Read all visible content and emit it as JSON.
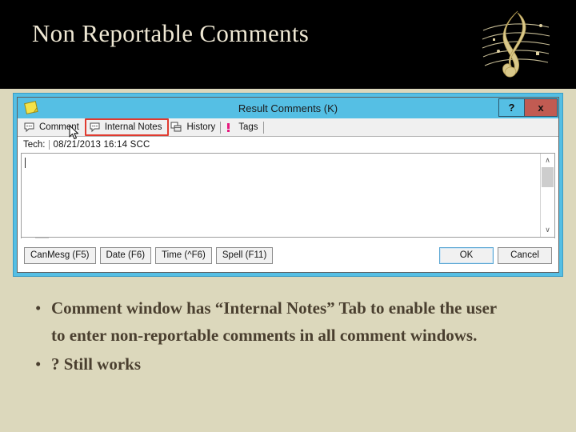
{
  "slide": {
    "title": "Non Reportable Comments",
    "decoration_icon": "treble-clef-icon",
    "background_color": "#dcd8bc",
    "header_color": "#000000",
    "title_color": "#efe8d4"
  },
  "dialog": {
    "window_icon": "sticky-note-icon",
    "title": "Result Comments (K)",
    "titlebar_color": "#55bfe4",
    "help_button": "?",
    "close_button": "x",
    "close_button_color": "#c15b52",
    "tabs": [
      {
        "label": "Comment",
        "icon": "speech-bubble-icon",
        "highlighted": false
      },
      {
        "label": "Internal Notes",
        "icon": "speech-bubble-icon",
        "highlighted": true
      },
      {
        "label": "History",
        "icon": "cascading-windows-icon",
        "highlighted": false
      },
      {
        "label": "Tags",
        "icon": "exclamation-mark-icon",
        "highlighted": false
      }
    ],
    "highlight_color": "#e03b30",
    "tech": {
      "label": "Tech:",
      "value": "08/21/2013  16:14  SCC"
    },
    "editor": {
      "value": "",
      "caret_visible": true
    },
    "scroll": {
      "up_arrow": "∧",
      "down_arrow": "∨",
      "left_arrow": "‹",
      "right_arrow": "›"
    },
    "buttons": {
      "left": [
        "CanMesg (F5)",
        "Date (F6)",
        "Time (^F6)",
        "Spell (F11)"
      ],
      "ok": "OK",
      "cancel": "Cancel"
    }
  },
  "bullets": [
    {
      "marker": "•",
      "text": "Comment window has “Internal Notes” Tab to enable the user to enter non-reportable comments in all comment windows."
    },
    {
      "marker": "•",
      "text": "? Still works"
    }
  ]
}
